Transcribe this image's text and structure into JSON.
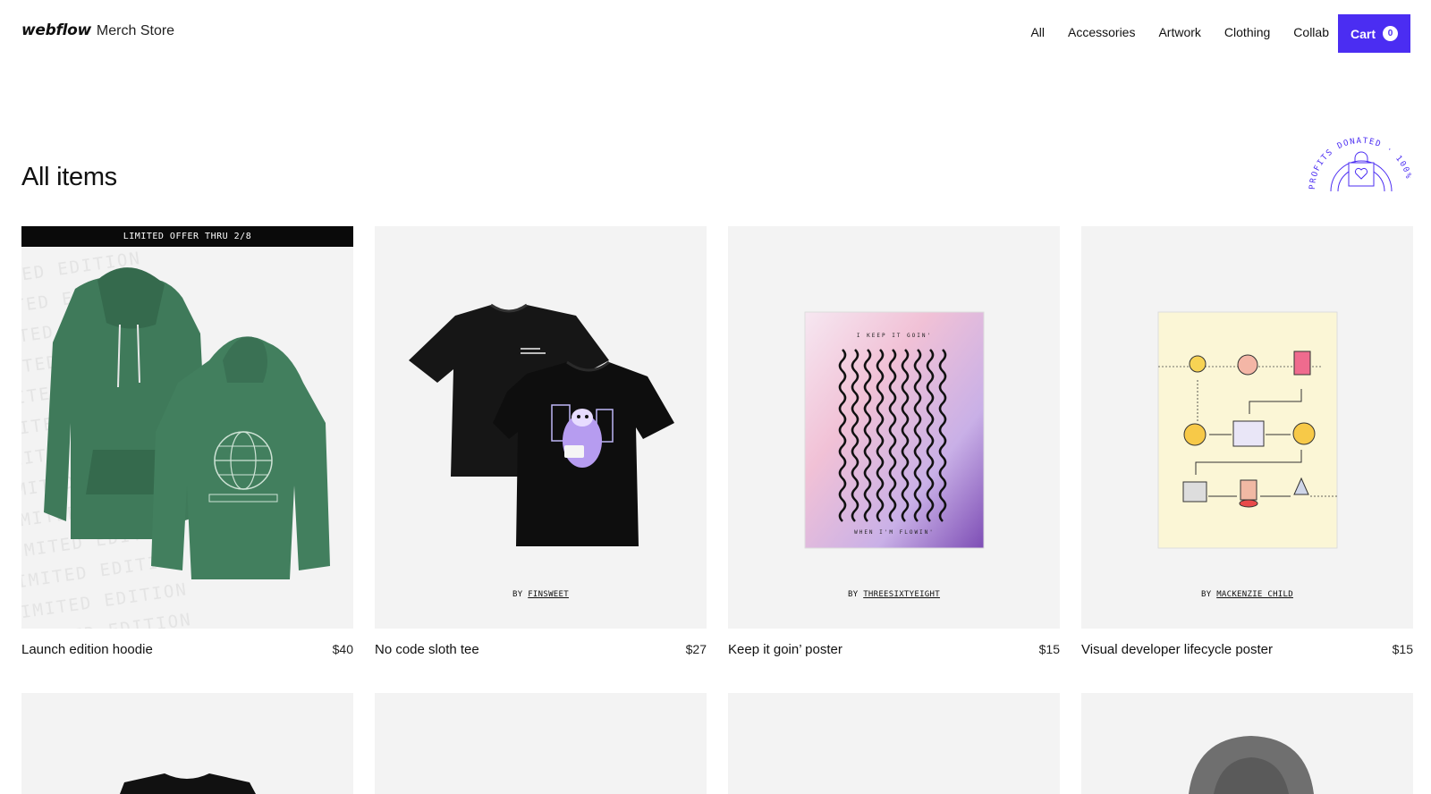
{
  "header": {
    "brand_logo": "webflow",
    "brand_sub": "Merch Store",
    "nav": [
      {
        "label": "All"
      },
      {
        "label": "Accessories"
      },
      {
        "label": "Artwork"
      },
      {
        "label": "Clothing"
      },
      {
        "label": "Collab"
      }
    ],
    "cart": {
      "label": "Cart",
      "count": "0"
    }
  },
  "page": {
    "title": "All items",
    "badge_text": "PROFITS DONATED · 100%"
  },
  "products": [
    {
      "title": "Launch edition hoodie",
      "price": "$40",
      "banner": "LIMITED OFFER THRU 2/8",
      "watermark": "LIMITED EDITION",
      "color": "#3f7a5a"
    },
    {
      "title": "No code sloth tee",
      "price": "$27",
      "by_prefix": "BY",
      "by_name": "FINSWEET"
    },
    {
      "title": "Keep it goin’ poster",
      "price": "$15",
      "by_prefix": "BY",
      "by_name": "THREESIXTYEIGHT",
      "poster_top": "I KEEP IT GOIN'",
      "poster_bottom": "WHEN I'M FLOWIN'"
    },
    {
      "title": "Visual developer lifecycle poster",
      "price": "$15",
      "by_prefix": "BY",
      "by_name": "MACKENZIE CHILD"
    }
  ],
  "colors": {
    "accent": "#4b2df2",
    "card_bg": "#f3f3f3"
  }
}
